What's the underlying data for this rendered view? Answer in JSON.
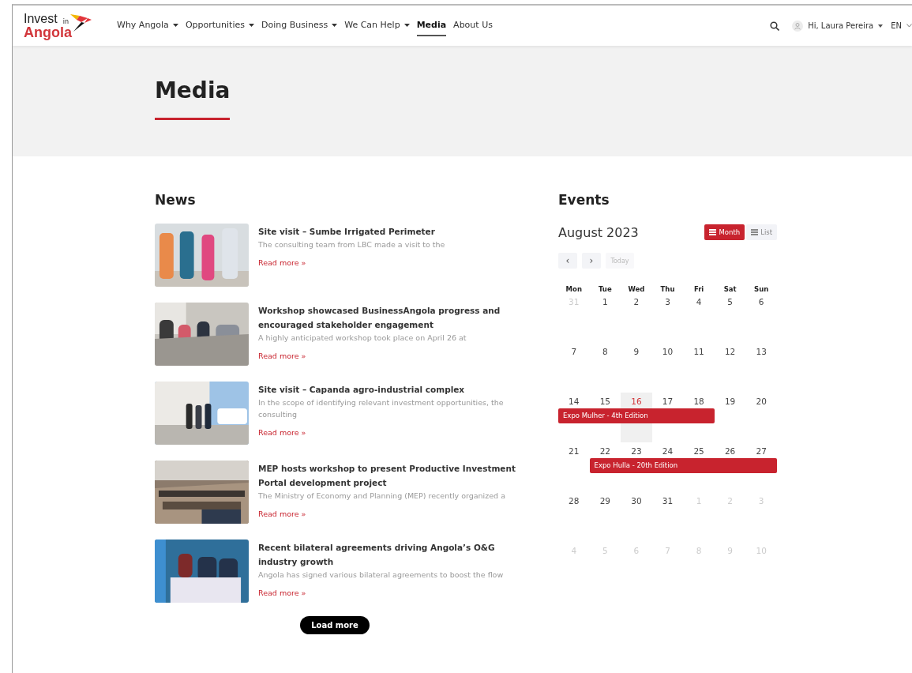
{
  "header": {
    "logo": {
      "line1": "Invest",
      "small": "in",
      "line2": "Angola"
    },
    "nav": [
      {
        "label": "Why Angola",
        "dropdown": true,
        "selected": false
      },
      {
        "label": "Opportunities",
        "dropdown": true,
        "selected": false
      },
      {
        "label": "Doing Business",
        "dropdown": true,
        "selected": false
      },
      {
        "label": "We Can Help",
        "dropdown": true,
        "selected": false
      },
      {
        "label": "Media",
        "dropdown": false,
        "selected": true
      },
      {
        "label": "About Us",
        "dropdown": false,
        "selected": false
      }
    ],
    "user": "Hi, Laura Pereira",
    "language": "EN"
  },
  "hero": {
    "title": "Media"
  },
  "news": {
    "title": "News",
    "items": [
      {
        "title": "Site visit – Sumbe Irrigated Perimeter",
        "excerpt": "The consulting team from LBC made a visit to the",
        "link": "Read more »"
      },
      {
        "title": "Workshop showcased BusinessAngola progress and encouraged stakeholder engagement",
        "excerpt": "A highly anticipated workshop took place on April 26 at",
        "link": "Read more »"
      },
      {
        "title": "Site visit – Capanda agro-industrial complex",
        "excerpt": "In the scope of identifying relevant investment opportunities, the consulting",
        "link": "Read more »"
      },
      {
        "title": "MEP hosts workshop to present Productive Investment Portal development project",
        "excerpt": "The Ministry of Economy and Planning (MEP) recently organized a",
        "link": "Read more »"
      },
      {
        "title": "Recent bilateral agreements driving Angola’s O&G industry growth",
        "excerpt": "Angola has signed various bilateral agreements to boost the flow",
        "link": "Read more »"
      }
    ],
    "load_more": "Load more"
  },
  "events": {
    "title": "Events",
    "month": "August 2023",
    "views": [
      {
        "label": "Month",
        "selected": true
      },
      {
        "label": "List",
        "selected": false
      }
    ],
    "prev": "‹",
    "next": "›",
    "today_button": "Today",
    "weekdays": [
      "Mon",
      "Tue",
      "Wed",
      "Thu",
      "Fri",
      "Sat",
      "Sun"
    ],
    "weeks": [
      {
        "days": [
          {
            "label": "31",
            "muted": true
          },
          {
            "label": "1",
            "muted": false
          },
          {
            "label": "2",
            "muted": false
          },
          {
            "label": "3",
            "muted": false
          },
          {
            "label": "4",
            "muted": false
          },
          {
            "label": "5",
            "muted": false
          },
          {
            "label": "6",
            "muted": false
          }
        ]
      },
      {
        "days": [
          {
            "label": "7",
            "muted": false
          },
          {
            "label": "8",
            "muted": false
          },
          {
            "label": "9",
            "muted": false
          },
          {
            "label": "10",
            "muted": false
          },
          {
            "label": "11",
            "muted": false
          },
          {
            "label": "12",
            "muted": false
          },
          {
            "label": "13",
            "muted": false
          }
        ]
      },
      {
        "days": [
          {
            "label": "14",
            "muted": false,
            "event": "Expo Mulher - 4th Edition"
          },
          {
            "label": "15",
            "muted": false,
            "covered": true
          },
          {
            "label": "16",
            "muted": false,
            "today": true,
            "covered": true
          },
          {
            "label": "17",
            "muted": false,
            "covered": true
          },
          {
            "label": "18",
            "muted": false,
            "covered": true
          },
          {
            "label": "19",
            "muted": false
          },
          {
            "label": "20",
            "muted": false
          }
        ]
      },
      {
        "days": [
          {
            "label": "21",
            "muted": false
          },
          {
            "label": "22",
            "muted": false,
            "event": "Expo Hulla - 20th Edition"
          },
          {
            "label": "23",
            "muted": false,
            "covered": true
          },
          {
            "label": "24",
            "muted": false,
            "covered": true
          },
          {
            "label": "25",
            "muted": false,
            "covered": true
          },
          {
            "label": "26",
            "muted": false,
            "covered": true
          },
          {
            "label": "27",
            "muted": false,
            "covered": true
          }
        ]
      },
      {
        "days": [
          {
            "label": "28",
            "muted": false
          },
          {
            "label": "29",
            "muted": false
          },
          {
            "label": "30",
            "muted": false
          },
          {
            "label": "31",
            "muted": false
          },
          {
            "label": "1",
            "muted": true
          },
          {
            "label": "2",
            "muted": true
          },
          {
            "label": "3",
            "muted": true
          }
        ]
      },
      {
        "days": [
          {
            "label": "4",
            "muted": true
          },
          {
            "label": "5",
            "muted": true
          },
          {
            "label": "6",
            "muted": true
          },
          {
            "label": "7",
            "muted": true
          },
          {
            "label": "8",
            "muted": true
          },
          {
            "label": "9",
            "muted": true
          },
          {
            "label": "10",
            "muted": true
          }
        ]
      }
    ]
  }
}
